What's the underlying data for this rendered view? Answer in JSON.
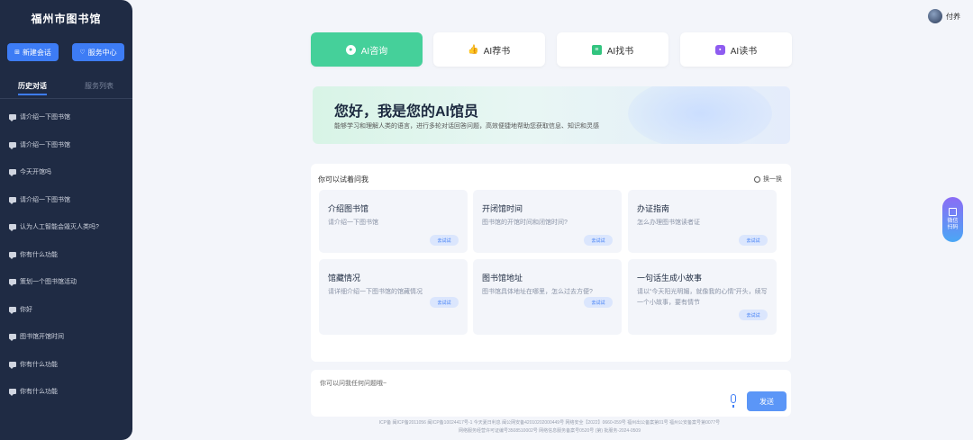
{
  "sidebar": {
    "title": "福州市图书馆",
    "new_chat": "新建会话",
    "service_center": "服务中心",
    "tabs": [
      "历史对话",
      "服务列表"
    ],
    "items": [
      "请介绍一下图书馆",
      "请介绍一下图书馆",
      "今天开馆吗",
      "请介绍一下图书馆",
      "认为人工智能会毁灭人类吗?",
      "你有什么功能",
      "策划一个图书馆活动",
      "你好",
      "图书馆开馆时间",
      "你有什么功能",
      "你有什么功能"
    ]
  },
  "user": {
    "name": "付养"
  },
  "top_tabs": [
    "AI咨询",
    "AI荐书",
    "AI找书",
    "AI读书"
  ],
  "banner": {
    "title": "您好，我是您的AI馆员",
    "subtitle": "能够学习和理解人类的语言，进行多轮对话回答问题，高效便捷地帮助您获取信息、知识和灵感"
  },
  "questions": {
    "title": "你可以试着问我",
    "refresh": "换一换",
    "try_label": "去试试",
    "cards": [
      {
        "title": "介绍图书馆",
        "desc": "请介绍一下图书馆"
      },
      {
        "title": "开闭馆时间",
        "desc": "图书馆的开馆时间和闭馆时间?"
      },
      {
        "title": "办证指南",
        "desc": "怎么办理图书馆读者证"
      },
      {
        "title": "馆藏情况",
        "desc": "请详细介绍一下图书馆的馆藏情况"
      },
      {
        "title": "图书馆地址",
        "desc": "图书馆具体地址在哪里，怎么过去方便?"
      },
      {
        "title": "一句话生成小故事",
        "desc": "请以“今天阳光明媚，就像我的心情”开头，续写一个小故事，要有情节"
      }
    ]
  },
  "input": {
    "placeholder": "你可以问我任何问题哦~",
    "send": "发送"
  },
  "footer": {
    "line1": "ICP备 闽ICP备2011056 闽ICP备10024417号-1   今天夏日利息   闽公网安备42010202000449号   网络安全【2022】0660-059号   福州出公备案第01号   福州公安备案号第0077号",
    "line2": "网络服务经营许可证编号3508510002号   网络信息服务备案号0520号   (第) 批服务-2024-0509"
  },
  "float": {
    "label": "微信扫码"
  },
  "colors": {
    "accent": "#3d7cf5",
    "active_tab": "#45d09a",
    "sidebar": "#1f2b44"
  }
}
